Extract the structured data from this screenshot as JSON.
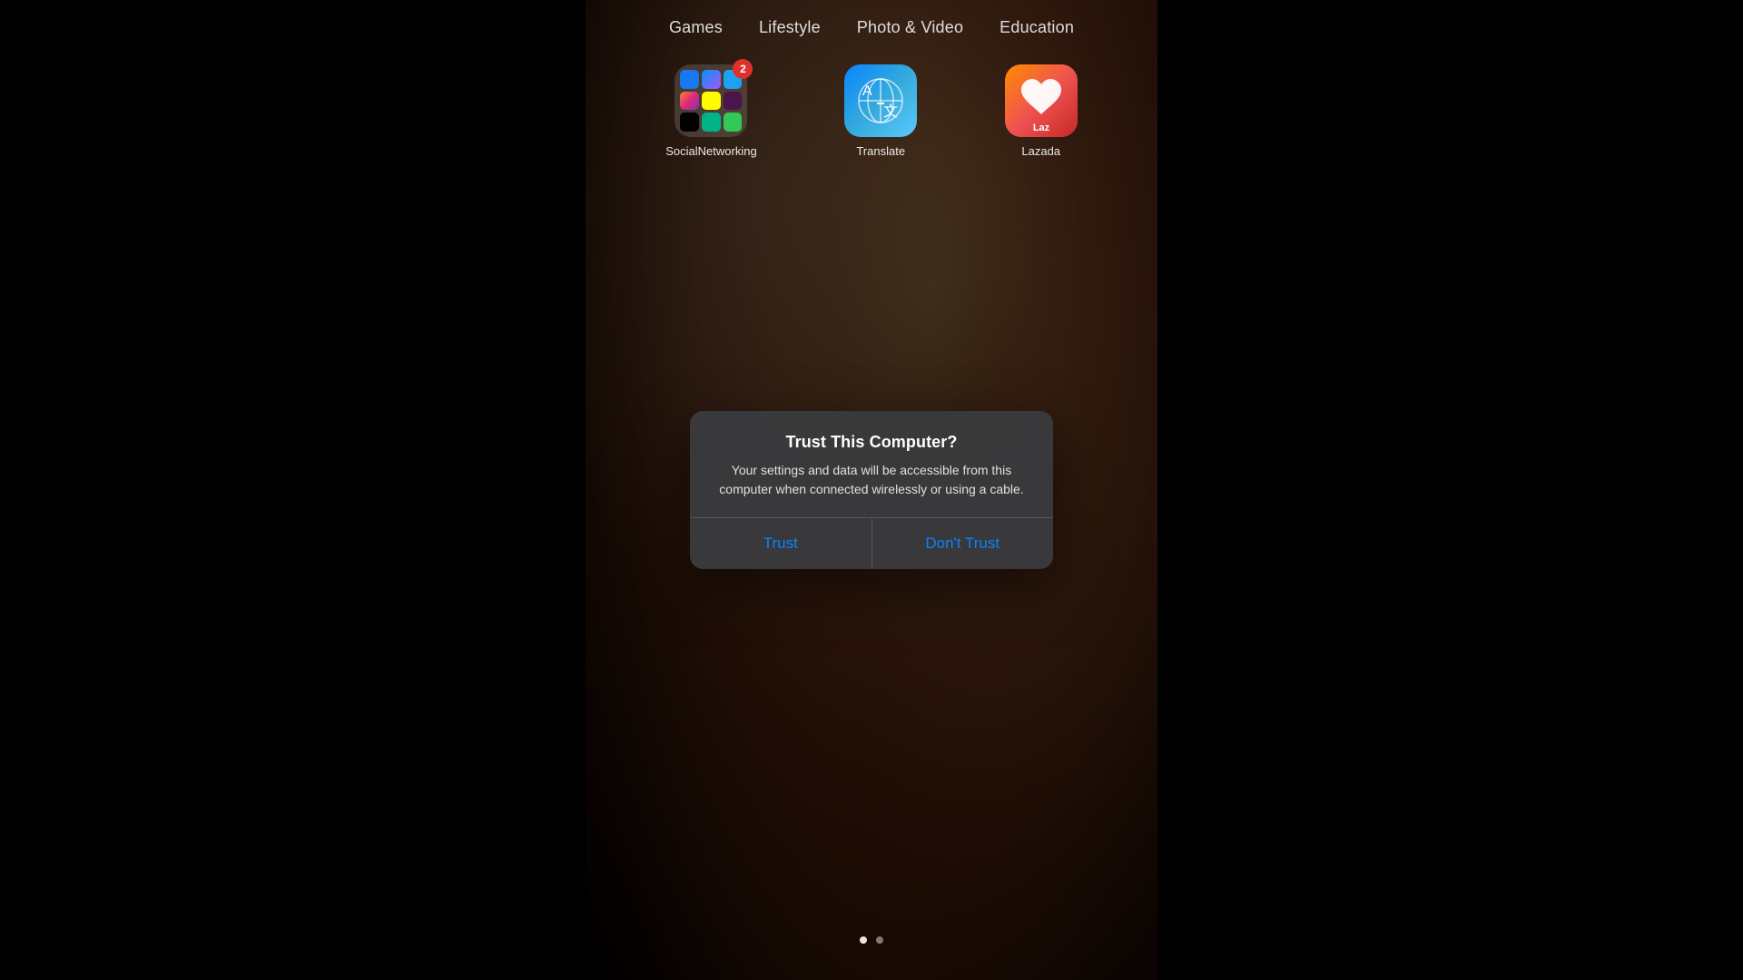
{
  "tabs": {
    "items": [
      {
        "id": "games",
        "label": "Games"
      },
      {
        "id": "lifestyle",
        "label": "Lifestyle"
      },
      {
        "id": "photo-video",
        "label": "Photo & Video"
      },
      {
        "id": "education",
        "label": "Education"
      }
    ]
  },
  "apps": {
    "folder": {
      "label": "SocialNetworking",
      "badge": "2",
      "mini_apps": [
        {
          "name": "Facebook",
          "class": "mini-fb"
        },
        {
          "name": "Messenger",
          "class": "mini-messenger"
        },
        {
          "name": "Twitter",
          "class": "mini-twitter"
        },
        {
          "name": "Instagram",
          "class": "mini-instagram"
        },
        {
          "name": "Snapchat",
          "class": "mini-snapchat"
        },
        {
          "name": "Slack",
          "class": "mini-slack"
        },
        {
          "name": "TikTok",
          "class": "mini-tiktok"
        },
        {
          "name": "Vine",
          "class": "mini-vine"
        },
        {
          "name": "FaceTime",
          "class": "mini-facetime"
        }
      ]
    },
    "translate": {
      "label": "Translate",
      "letter_a": "A",
      "letter_x": "文"
    },
    "lazada": {
      "label": "Lazada",
      "text": "Laz"
    }
  },
  "dialog": {
    "title": "Trust This Computer?",
    "message": "Your settings and data will be accessible from this computer when connected wirelessly or using a cable.",
    "trust_label": "Trust",
    "dont_trust_label": "Don't Trust"
  },
  "page_dots": {
    "dot1_active": true,
    "dot2_active": false
  }
}
